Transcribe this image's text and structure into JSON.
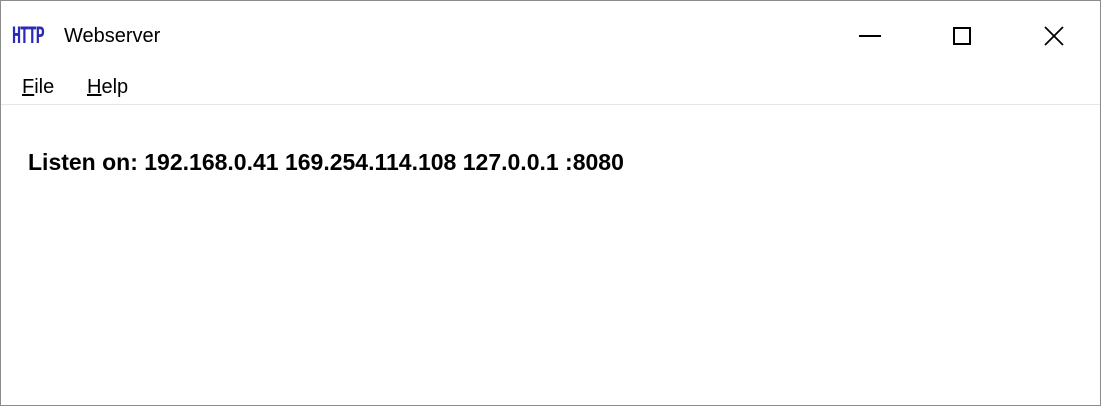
{
  "window": {
    "title": "Webserver",
    "icon_text": "HTTP",
    "icon_color": "#2a2ab8"
  },
  "controls": {
    "minimize_icon": "minimize-icon",
    "maximize_icon": "maximize-icon",
    "close_icon": "close-icon"
  },
  "menu": {
    "file": {
      "mnemonic": "F",
      "rest": "ile"
    },
    "help": {
      "mnemonic": "H",
      "rest": "elp"
    }
  },
  "content": {
    "listen_text": "Listen on: 192.168.0.41 169.254.114.108 127.0.0.1 :8080"
  }
}
